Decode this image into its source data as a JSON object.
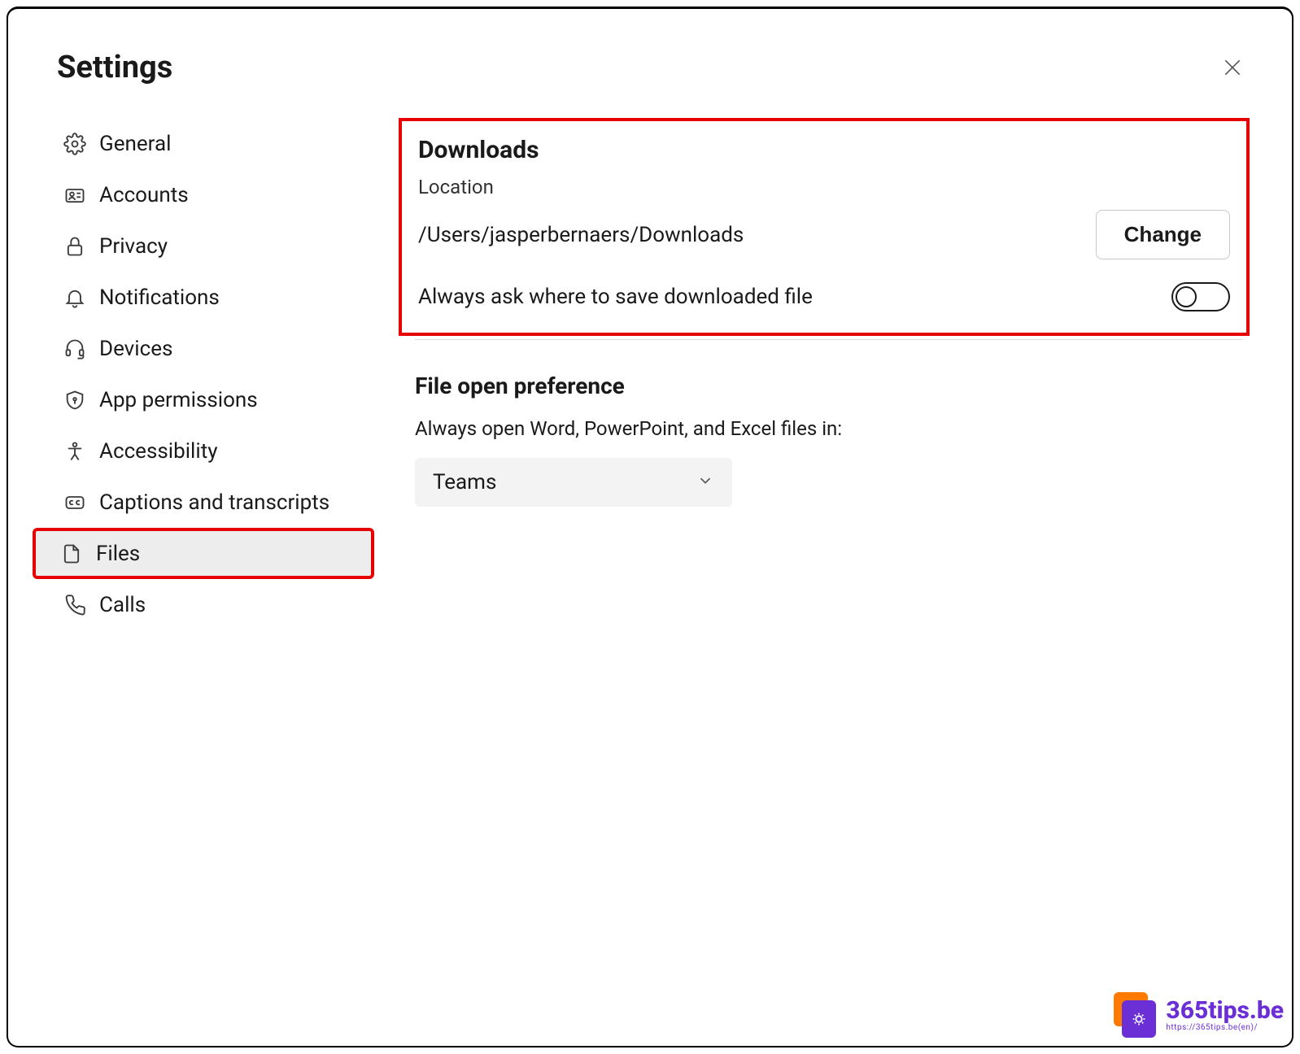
{
  "page_title": "Settings",
  "sidebar": {
    "items": [
      {
        "id": "general",
        "label": "General",
        "icon": "gear-icon",
        "active": false
      },
      {
        "id": "accounts",
        "label": "Accounts",
        "icon": "id-card-icon",
        "active": false
      },
      {
        "id": "privacy",
        "label": "Privacy",
        "icon": "lock-icon",
        "active": false
      },
      {
        "id": "notifications",
        "label": "Notifications",
        "icon": "bell-icon",
        "active": false
      },
      {
        "id": "devices",
        "label": "Devices",
        "icon": "headset-icon",
        "active": false
      },
      {
        "id": "app-permissions",
        "label": "App permissions",
        "icon": "shield-key-icon",
        "active": false
      },
      {
        "id": "accessibility",
        "label": "Accessibility",
        "icon": "person-icon",
        "active": false
      },
      {
        "id": "captions",
        "label": "Captions and transcripts",
        "icon": "cc-icon",
        "active": false
      },
      {
        "id": "files",
        "label": "Files",
        "icon": "file-icon",
        "active": true,
        "highlight": true
      },
      {
        "id": "calls",
        "label": "Calls",
        "icon": "phone-icon",
        "active": false
      }
    ]
  },
  "downloads": {
    "heading": "Downloads",
    "location_label": "Location",
    "location_path": "/Users/jasperbernaers/Downloads",
    "change_label": "Change",
    "always_ask_label": "Always ask where to save downloaded file",
    "always_ask_value": false
  },
  "file_open": {
    "heading": "File open preference",
    "subtext": "Always open Word, PowerPoint, and Excel files in:",
    "dropdown_value": "Teams"
  },
  "watermark": {
    "text": "365tips.be",
    "sub": "https://365tips.be(en)/"
  }
}
